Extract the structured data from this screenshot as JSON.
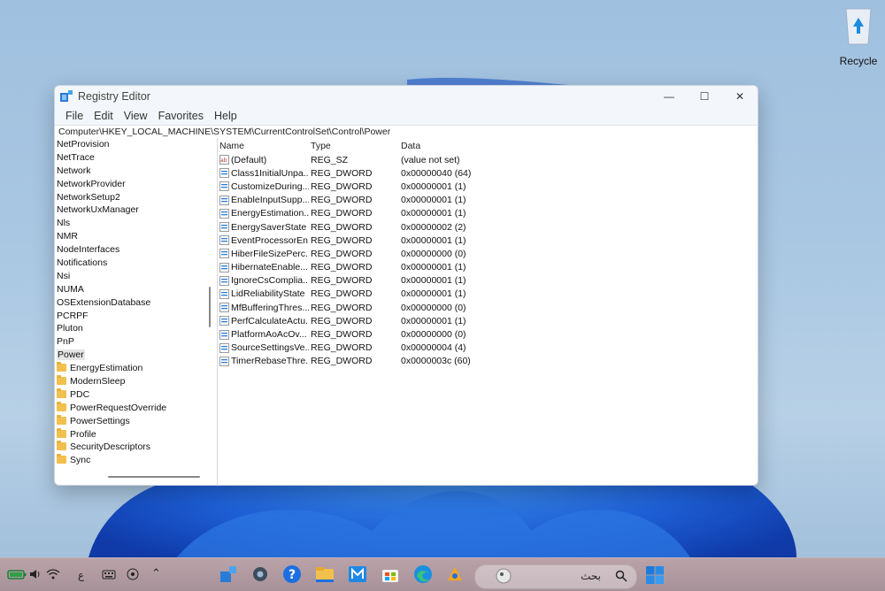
{
  "desktop": {
    "recycle_bin_label": "Recycle"
  },
  "window": {
    "title": "Registry Editor",
    "controls": {
      "minimize": "—",
      "maximize": "☐",
      "close": "✕"
    },
    "menu": [
      "File",
      "Edit",
      "View",
      "Favorites",
      "Help"
    ],
    "address": "Computer\\HKEY_LOCAL_MACHINE\\SYSTEM\\CurrentControlSet\\Control\\Power"
  },
  "tree": {
    "items": [
      {
        "label": "NetProvision",
        "level": 0
      },
      {
        "label": "NetTrace",
        "level": 0
      },
      {
        "label": "Network",
        "level": 0
      },
      {
        "label": "NetworkProvider",
        "level": 0
      },
      {
        "label": "NetworkSetup2",
        "level": 0
      },
      {
        "label": "NetworkUxManager",
        "level": 0
      },
      {
        "label": "Nls",
        "level": 0
      },
      {
        "label": "NMR",
        "level": 0
      },
      {
        "label": "NodeInterfaces",
        "level": 0
      },
      {
        "label": "Notifications",
        "level": 0
      },
      {
        "label": "Nsi",
        "level": 0
      },
      {
        "label": "NUMA",
        "level": 0
      },
      {
        "label": "OSExtensionDatabase",
        "level": 0
      },
      {
        "label": "PCRPF",
        "level": 0
      },
      {
        "label": "Pluton",
        "level": 0
      },
      {
        "label": "PnP",
        "level": 0
      },
      {
        "label": "Power",
        "level": 0,
        "selected": true
      },
      {
        "label": "EnergyEstimation",
        "level": 1
      },
      {
        "label": "ModernSleep",
        "level": 1
      },
      {
        "label": "PDC",
        "level": 1
      },
      {
        "label": "PowerRequestOverride",
        "level": 1
      },
      {
        "label": "PowerSettings",
        "level": 1
      },
      {
        "label": "Profile",
        "level": 1
      },
      {
        "label": "SecurityDescriptors",
        "level": 1
      },
      {
        "label": "Sync",
        "level": 1
      }
    ]
  },
  "values_table": {
    "columns": [
      "Name",
      "Type",
      "Data"
    ],
    "rows": [
      {
        "icon": "string-value-icon",
        "name": "(Default)",
        "type": "REG_SZ",
        "data": "(value not set)"
      },
      {
        "icon": "binary-value-icon",
        "name": "Class1InitialUnpa...",
        "type": "REG_DWORD",
        "data": "0x00000040 (64)"
      },
      {
        "icon": "binary-value-icon",
        "name": "CustomizeDuring...",
        "type": "REG_DWORD",
        "data": "0x00000001 (1)"
      },
      {
        "icon": "binary-value-icon",
        "name": "EnableInputSupp...",
        "type": "REG_DWORD",
        "data": "0x00000001 (1)"
      },
      {
        "icon": "binary-value-icon",
        "name": "EnergyEstimation...",
        "type": "REG_DWORD",
        "data": "0x00000001 (1)"
      },
      {
        "icon": "binary-value-icon",
        "name": "EnergySaverState",
        "type": "REG_DWORD",
        "data": "0x00000002 (2)"
      },
      {
        "icon": "binary-value-icon",
        "name": "EventProcessorEn...",
        "type": "REG_DWORD",
        "data": "0x00000001 (1)"
      },
      {
        "icon": "binary-value-icon",
        "name": "HiberFileSizePerc...",
        "type": "REG_DWORD",
        "data": "0x00000000 (0)"
      },
      {
        "icon": "binary-value-icon",
        "name": "HibernateEnable...",
        "type": "REG_DWORD",
        "data": "0x00000001 (1)"
      },
      {
        "icon": "binary-value-icon",
        "name": "IgnoreCsComplia...",
        "type": "REG_DWORD",
        "data": "0x00000001 (1)"
      },
      {
        "icon": "binary-value-icon",
        "name": "LidReliabilityState",
        "type": "REG_DWORD",
        "data": "0x00000001 (1)"
      },
      {
        "icon": "binary-value-icon",
        "name": "MfBufferingThres...",
        "type": "REG_DWORD",
        "data": "0x00000000 (0)"
      },
      {
        "icon": "binary-value-icon",
        "name": "PerfCalculateActu...",
        "type": "REG_DWORD",
        "data": "0x00000001 (1)"
      },
      {
        "icon": "binary-value-icon",
        "name": "PlatformAoAcOv...",
        "type": "REG_DWORD",
        "data": "0x00000000 (0)"
      },
      {
        "icon": "binary-value-icon",
        "name": "SourceSettingsVe...",
        "type": "REG_DWORD",
        "data": "0x00000004 (4)"
      },
      {
        "icon": "binary-value-icon",
        "name": "TimerRebaseThre...",
        "type": "REG_DWORD",
        "data": "0x0000003c (60)"
      }
    ]
  },
  "taskbar": {
    "search_text": "بحث",
    "input_indicator": "ع",
    "accent": "#0078d4"
  }
}
